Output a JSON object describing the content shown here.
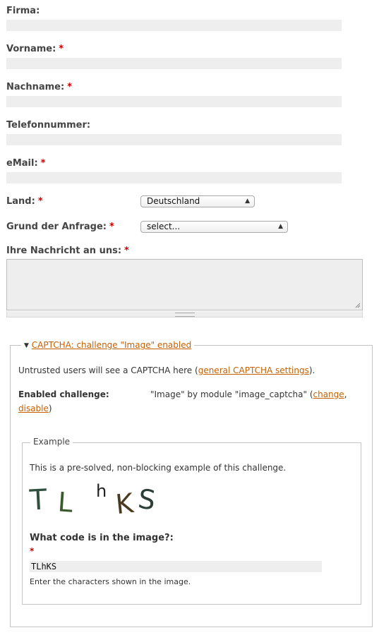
{
  "form": {
    "firma_label": "Firma:",
    "vorname_label": "Vorname:",
    "nachname_label": "Nachname:",
    "telefon_label": "Telefonnummer:",
    "email_label": "eMail:",
    "land_label": "Land:",
    "land_value": "Deutschland",
    "grund_label": "Grund der Anfrage:",
    "grund_value": "select...",
    "nachricht_label": "Ihre Nachricht an uns:",
    "required_marker": "*"
  },
  "captcha": {
    "legend": "CAPTCHA: challenge \"Image\" enabled",
    "untrusted_prefix": "Untrusted users will see a CAPTCHA here (",
    "settings_link": "general CAPTCHA settings",
    "untrusted_suffix": ").",
    "enabled_label": "Enabled challenge:",
    "enabled_value_prefix": "\"Image\" by module \"image_captcha\" (",
    "change_link": "change",
    "comma": ",",
    "disable_link": "disable",
    "close_paren": ")",
    "example": {
      "legend": "Example",
      "description": "This is a pre-solved, non-blocking example of this challenge.",
      "image_chars": [
        "T",
        "L",
        "h",
        "K",
        "S"
      ],
      "question": "What code is in the image?:",
      "required_marker": "*",
      "answer": "TLhKS",
      "help": "Enter the characters shown in the image."
    }
  },
  "colors": {
    "accent_link": "#c66000",
    "required": "#cc0000",
    "field_bg": "#eeeeee"
  }
}
